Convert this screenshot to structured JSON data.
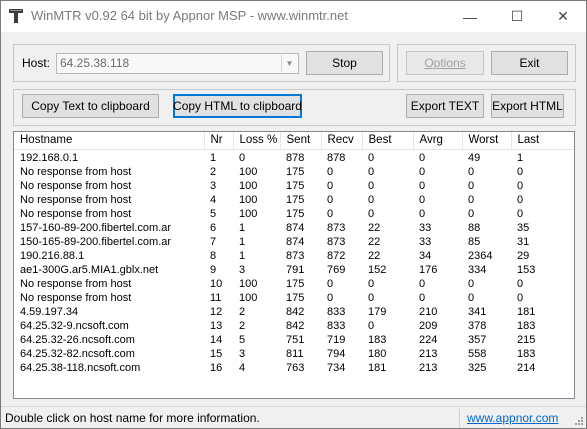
{
  "window": {
    "title": "WinMTR v0.92 64 bit by Appnor MSP - www.winmtr.net",
    "minimize_glyph": "—",
    "maximize_glyph": "☐",
    "close_glyph": "✕"
  },
  "host": {
    "label": "Host:",
    "value": "64.25.38.118"
  },
  "buttons": {
    "stop": "Stop",
    "options": "Options",
    "exit": "Exit",
    "copy_text": "Copy Text to clipboard",
    "copy_html": "Copy HTML to clipboard",
    "export_text": "Export TEXT",
    "export_html": "Export HTML"
  },
  "table": {
    "columns": [
      "Hostname",
      "Nr",
      "Loss %",
      "Sent",
      "Recv",
      "Best",
      "Avrg",
      "Worst",
      "Last"
    ],
    "rows": [
      [
        "192.168.0.1",
        "1",
        "0",
        "878",
        "878",
        "0",
        "0",
        "49",
        "1"
      ],
      [
        "No response from host",
        "2",
        "100",
        "175",
        "0",
        "0",
        "0",
        "0",
        "0"
      ],
      [
        "No response from host",
        "3",
        "100",
        "175",
        "0",
        "0",
        "0",
        "0",
        "0"
      ],
      [
        "No response from host",
        "4",
        "100",
        "175",
        "0",
        "0",
        "0",
        "0",
        "0"
      ],
      [
        "No response from host",
        "5",
        "100",
        "175",
        "0",
        "0",
        "0",
        "0",
        "0"
      ],
      [
        "157-160-89-200.fibertel.com.ar",
        "6",
        "1",
        "874",
        "873",
        "22",
        "33",
        "88",
        "35"
      ],
      [
        "150-165-89-200.fibertel.com.ar",
        "7",
        "1",
        "874",
        "873",
        "22",
        "33",
        "85",
        "31"
      ],
      [
        "190.216.88.1",
        "8",
        "1",
        "873",
        "872",
        "22",
        "34",
        "2364",
        "29"
      ],
      [
        "ae1-300G.ar5.MIA1.gblx.net",
        "9",
        "3",
        "791",
        "769",
        "152",
        "176",
        "334",
        "153"
      ],
      [
        "No response from host",
        "10",
        "100",
        "175",
        "0",
        "0",
        "0",
        "0",
        "0"
      ],
      [
        "No response from host",
        "11",
        "100",
        "175",
        "0",
        "0",
        "0",
        "0",
        "0"
      ],
      [
        "4.59.197.34",
        "12",
        "2",
        "842",
        "833",
        "179",
        "210",
        "341",
        "181"
      ],
      [
        "64.25.32-9.ncsoft.com",
        "13",
        "2",
        "842",
        "833",
        "0",
        "209",
        "378",
        "183"
      ],
      [
        "64.25.32-26.ncsoft.com",
        "14",
        "5",
        "751",
        "719",
        "183",
        "224",
        "357",
        "215"
      ],
      [
        "64.25.32-82.ncsoft.com",
        "15",
        "3",
        "811",
        "794",
        "180",
        "213",
        "558",
        "183"
      ],
      [
        "64.25.38-118.ncsoft.com",
        "16",
        "4",
        "763",
        "734",
        "181",
        "213",
        "325",
        "214"
      ]
    ]
  },
  "status": {
    "text": "Double click on host name for more information.",
    "link": "www.appnor.com"
  },
  "icons": {
    "app": "winmtr-app-icon",
    "combo": "chevron-down-icon",
    "grip": "resize-grip-icon"
  }
}
